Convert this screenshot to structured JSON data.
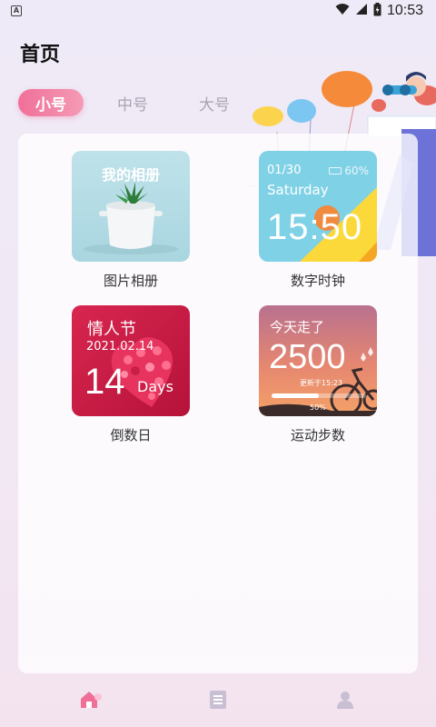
{
  "status_bar": {
    "notification_icon_letter": "A",
    "time": "10:53",
    "icons": [
      "wifi-icon",
      "signal-icon",
      "battery-icon"
    ]
  },
  "page": {
    "title": "首页"
  },
  "size_tabs": [
    {
      "label": "小号",
      "active": true
    },
    {
      "label": "中号",
      "active": false
    },
    {
      "label": "大号",
      "active": false
    }
  ],
  "widgets": [
    {
      "label": "图片相册",
      "thumb": {
        "title": "我的相册"
      }
    },
    {
      "label": "数字时钟",
      "thumb": {
        "date": "01/30",
        "battery": "60%",
        "weekday": "Saturday",
        "time": "15:50"
      }
    },
    {
      "label": "倒数日",
      "thumb": {
        "title": "情人节",
        "date": "2021.02.14",
        "count": "14",
        "unit": "Days"
      }
    },
    {
      "label": "运动步数",
      "thumb": {
        "title": "今天走了",
        "steps": "2500",
        "updated": "更新于15:23",
        "progress_label": "50%",
        "progress": 0.5
      }
    }
  ],
  "bottom_nav": [
    {
      "name": "home",
      "icon": "home-icon",
      "active": true
    },
    {
      "name": "list",
      "icon": "document-icon",
      "active": false
    },
    {
      "name": "profile",
      "icon": "user-icon",
      "active": false
    }
  ],
  "colors": {
    "accent": "#f06f98",
    "tab_inactive": "#a9a3b3",
    "nav_inactive": "#c9bfd3"
  }
}
